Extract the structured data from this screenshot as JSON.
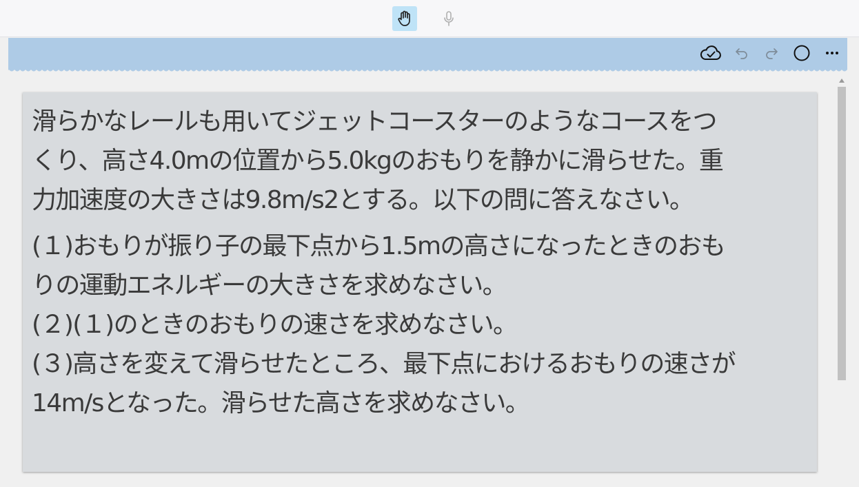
{
  "toolbar": {
    "hand_tool": "hand-tool",
    "mic_tool": "microphone"
  },
  "ribbon": {
    "icons": [
      "cloud-check-icon",
      "undo-icon",
      "redo-icon",
      "circle-icon",
      "more-icon"
    ]
  },
  "note": {
    "intro_lines": [
      "滑らかなレールも用いてジェットコースターのようなコースをつ",
      "くり、高さ4.0mの位置から5.0kgのおもりを静かに滑らせた。重",
      "力加速度の大きさは9.8m/s2とする。以下の問に答えなさい。"
    ],
    "question_lines": [
      "(１)おもりが振り子の最下点から1.5mの高さになったときのおも",
      "りの運動エネルギーの大きさを求めなさい。",
      "(２)(１)のときのおもりの速さを求めなさい。",
      "(３)高さを変えて滑らせたところ、最下点におけるおもりの速さが",
      "14m/sとなった。滑らせた高さを求めなさい。"
    ]
  },
  "colors": {
    "ribbon": "#aecbe6",
    "note_bg": "#d8dbde",
    "active_tool": "#bfe3f7"
  }
}
